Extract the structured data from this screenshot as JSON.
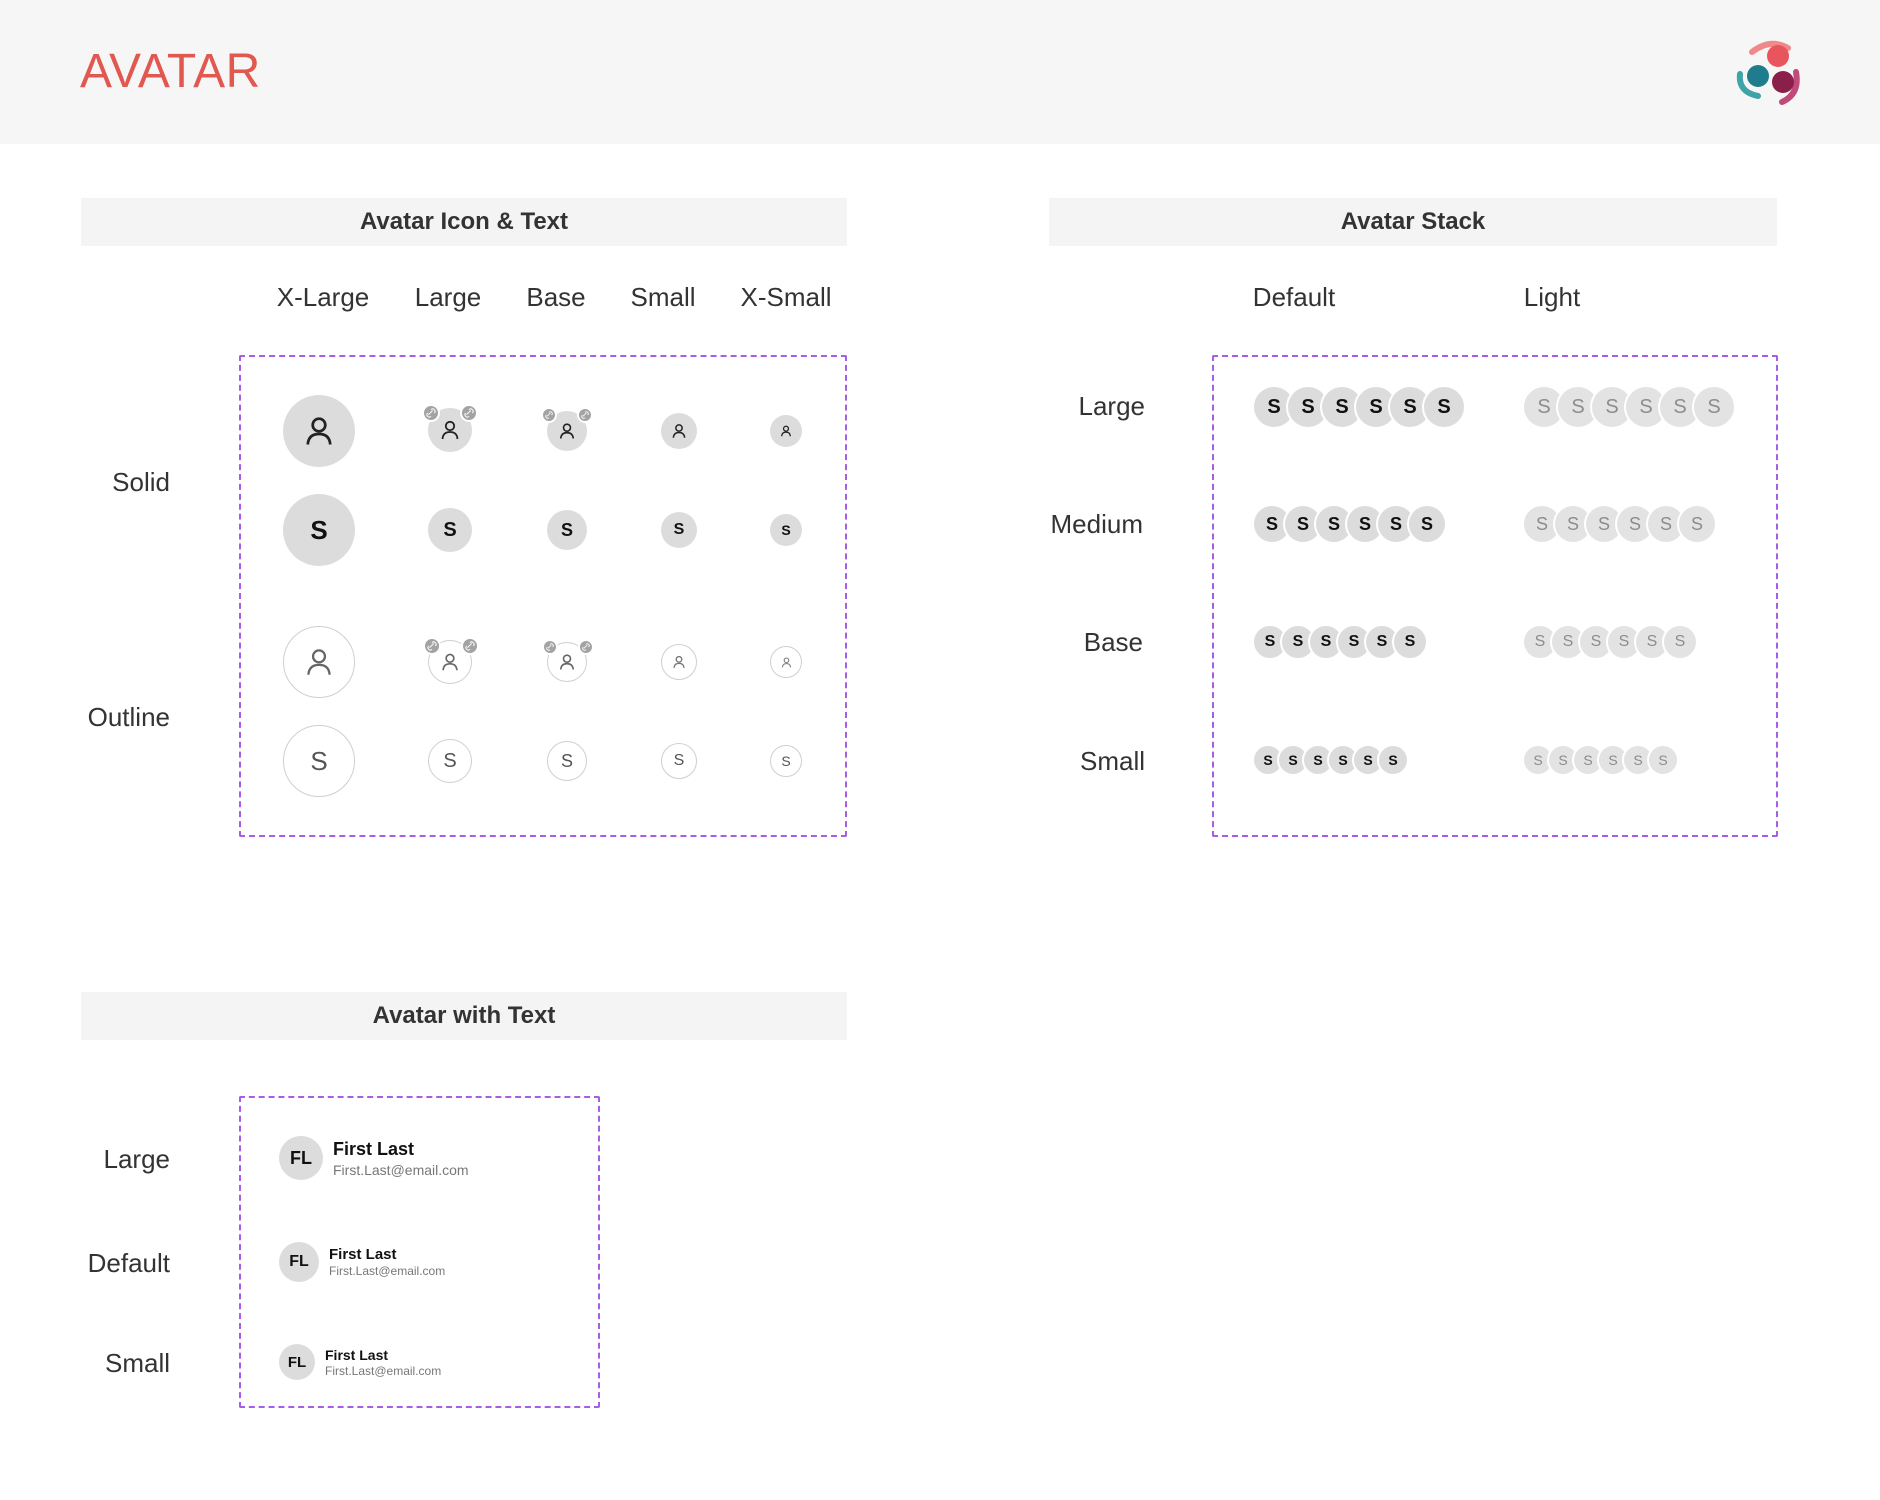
{
  "page": {
    "title": "AVATAR"
  },
  "colors": {
    "accent": "#e0584f",
    "dash": "#a65ee6",
    "solid_bg": "#dcdcdc",
    "badge": "#a3a3a3"
  },
  "icon_text": {
    "title": "Avatar Icon & Text",
    "columns": [
      "X-Large",
      "Large",
      "Base",
      "Small",
      "X-Small"
    ],
    "rows": [
      "Solid",
      "Outline"
    ],
    "initial": "S",
    "icon": "user-icon",
    "badge_icon": "link-icon"
  },
  "stack": {
    "title": "Avatar Stack",
    "columns": [
      "Default",
      "Light"
    ],
    "rows": [
      "Large",
      "Medium",
      "Base",
      "Small"
    ],
    "initials": [
      "S",
      "S",
      "S",
      "S",
      "S",
      "S"
    ]
  },
  "with_text": {
    "title": "Avatar with Text",
    "rows": [
      {
        "label": "Large",
        "initials": "FL",
        "name": "First Last",
        "email": "First.Last@email.com"
      },
      {
        "label": "Default",
        "initials": "FL",
        "name": "First Last",
        "email": "First.Last@email.com"
      },
      {
        "label": "Small",
        "initials": "FL",
        "name": "First Last",
        "email": "First.Last@email.com"
      }
    ]
  }
}
